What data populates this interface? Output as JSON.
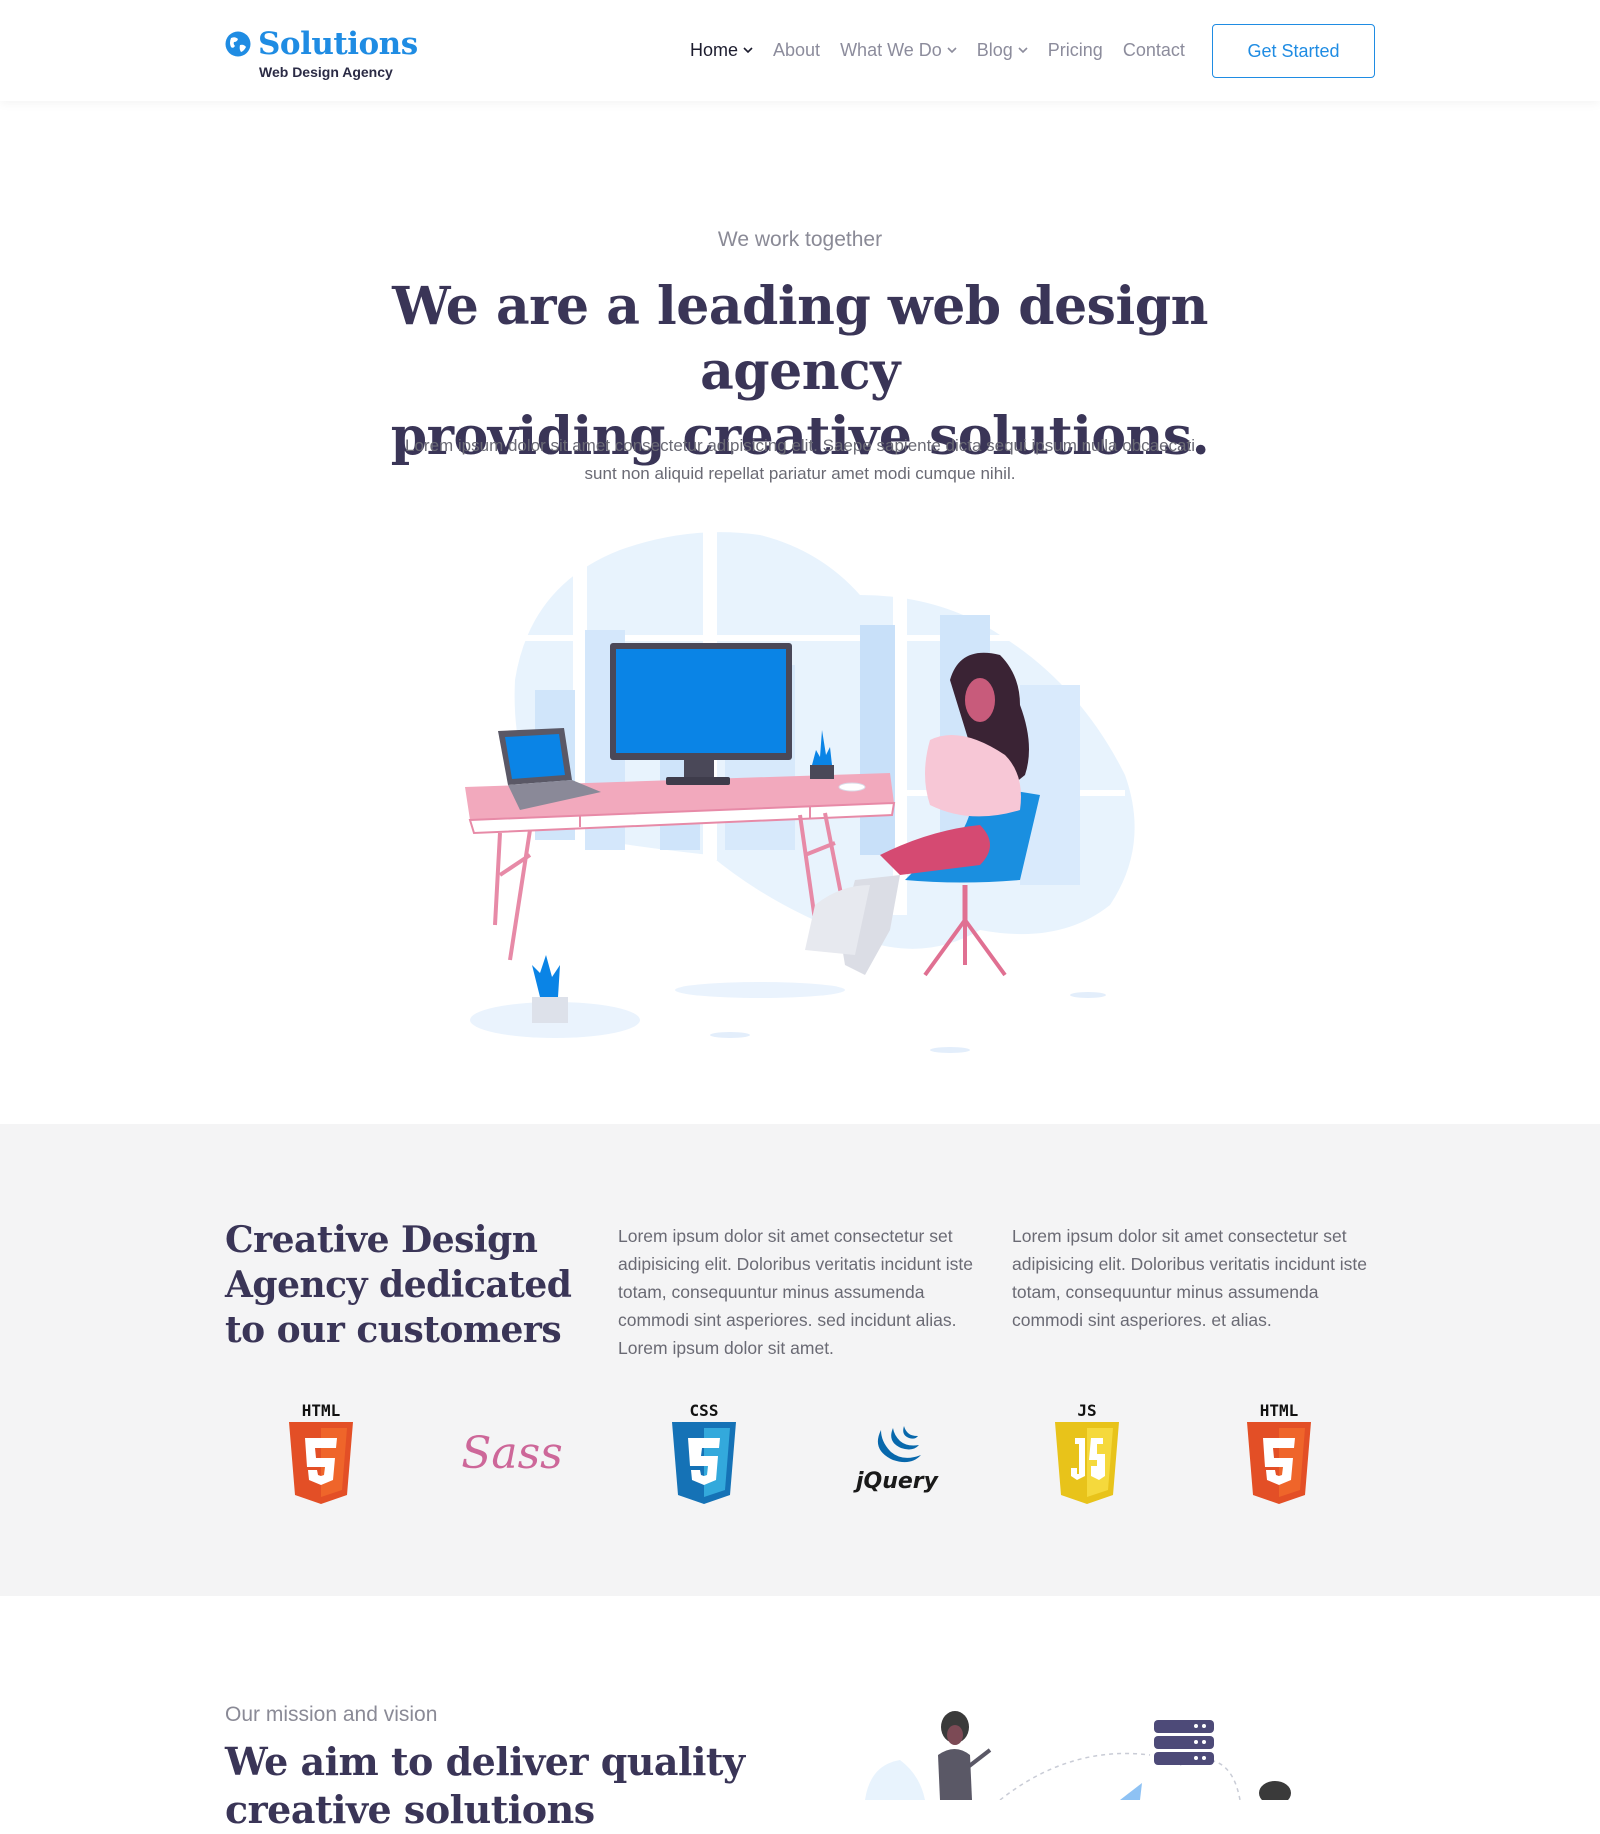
{
  "header": {
    "logo_name": "Solutions",
    "logo_tagline": "Web Design Agency",
    "nav": [
      {
        "label": "Home",
        "dropdown": true,
        "active": true
      },
      {
        "label": "About",
        "dropdown": false
      },
      {
        "label": "What We Do",
        "dropdown": true
      },
      {
        "label": "Blog",
        "dropdown": true
      },
      {
        "label": "Pricing",
        "dropdown": false
      },
      {
        "label": "Contact",
        "dropdown": false
      }
    ],
    "cta_label": "Get Started"
  },
  "hero": {
    "eyebrow": "We work together",
    "title_line1": "We are a leading web design agency",
    "title_line2": "providing creative solutions.",
    "body": "Lorem ipsum dolor sit amet consectetur adipisicing elit. Saepe sapiente dicta sequi ipsum nulla obcaecati sunt non aliquid repellat pariatur amet modi cumque nihil."
  },
  "about": {
    "title": "Creative Design Agency dedicated to our customers",
    "col1": "Lorem ipsum dolor sit amet consectetur set adipisicing elit. Doloribus veritatis incidunt iste totam, consequuntur minus assumenda commodi sint asperiores. sed incidunt alias. Lorem ipsum dolor sit amet.",
    "col2": "Lorem ipsum dolor sit amet consectetur set adipisicing elit. Doloribus veritatis incidunt iste totam, consequuntur minus assumenda commodi sint asperiores. et alias.",
    "tech_labels": [
      "HTML",
      "CSS",
      "JS",
      "HTML"
    ],
    "sass_logo_text": "Sass",
    "jquery_logo_text": "jQuery"
  },
  "mission": {
    "eyebrow": "Our mission and vision",
    "title": "We aim to deliver quality creative solutions"
  },
  "colors": {
    "brand": "#1f8ce3",
    "heading": "#3a3557",
    "band_bg": "#f4f4f5",
    "html_orange": "#e34f26",
    "css_blue": "#1572b6",
    "js_yellow": "#e8c31a",
    "sass_pink": "#cd6799"
  }
}
